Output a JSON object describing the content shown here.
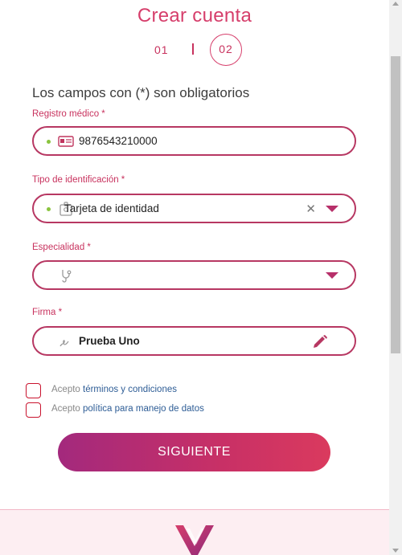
{
  "header": {
    "title": "Crear cuenta",
    "step_one": "01",
    "step_two": "02",
    "current_step": 2
  },
  "form": {
    "required_note": "Los campos con (*) son obligatorios",
    "registro_medico": {
      "label": "Registro médico *",
      "value": "9876543210000",
      "icon": "id-card-icon"
    },
    "tipo_identificacion": {
      "label": "Tipo de identificación *",
      "value": "Tarjeta de identidad",
      "icon": "id-badge-icon"
    },
    "especialidad": {
      "label": "Especialidad *",
      "value": "",
      "icon": "stethoscope-icon"
    },
    "firma": {
      "label": "Firma *",
      "value": "Prueba Uno",
      "icon": "signature-icon"
    },
    "terms": {
      "prefix": "Acepto",
      "link": "términos y condiciones"
    },
    "policy": {
      "prefix": "Acepto",
      "link": "política para manejo de datos"
    },
    "submit_label": "SIGUIENTE"
  },
  "colors": {
    "accent": "#d63e6b",
    "field_border": "#b73762",
    "status_dot": "#8ac43f",
    "link": "#2d5c95",
    "checkbox_border": "#c9132e",
    "footer_bg": "#fdeef2"
  }
}
